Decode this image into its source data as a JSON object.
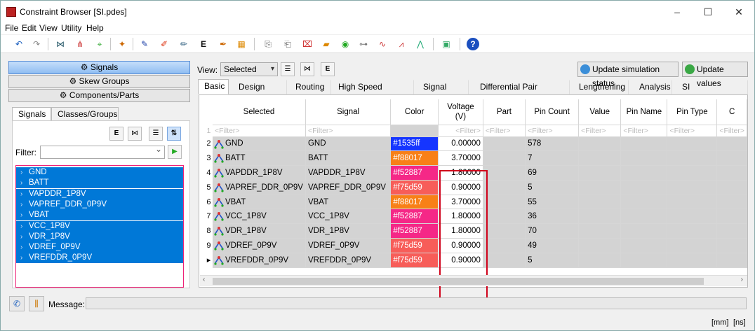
{
  "window": {
    "title": "Constraint Browser [SI.pdes]"
  },
  "menu": [
    "File",
    "Edit",
    "View",
    "Utility",
    "Help"
  ],
  "left": {
    "nav": {
      "signals": "Signals",
      "skew_groups": "Skew Groups",
      "components": "Components/Parts"
    },
    "tabs": [
      "Signals",
      "Classes/Groups"
    ],
    "filter_label": "Filter:",
    "nets": [
      "GND",
      "BATT",
      "VAPDDR_1P8V",
      "VAPREF_DDR_0P9V",
      "VBAT",
      "VCC_1P8V",
      "VDR_1P8V",
      "VDREF_0P9V",
      "VREFDDR_0P9V"
    ]
  },
  "right": {
    "view_label": "View:",
    "view_value": "Selected",
    "update_sim": "Update simulation status",
    "update_values": "Update values",
    "tabs": [
      "Basic",
      "Design Rule",
      "Routing",
      "High Speed Routing",
      "Signal Class",
      "Differential Pair Routing",
      "Lengthening",
      "Analysis",
      "SI Measurements"
    ],
    "columns": [
      "Selected",
      "Signal",
      "Color",
      "Voltage\n(V)",
      "Part",
      "Pin Count",
      "Value",
      "Pin Name",
      "Pin Type",
      "C"
    ],
    "filter_placeholder": "<Filter>",
    "row_numbers": [
      "1",
      "2",
      "3",
      "4",
      "5",
      "6",
      "7",
      "8",
      "9",
      "▸"
    ],
    "rows": [
      {
        "selected": "GND",
        "signal": "GND",
        "color": "#1535ff",
        "voltage": "0.00000",
        "pin_count": "578"
      },
      {
        "selected": "BATT",
        "signal": "BATT",
        "color": "#f88017",
        "voltage": "3.70000",
        "pin_count": "7"
      },
      {
        "selected": "VAPDDR_1P8V",
        "signal": "VAPDDR_1P8V",
        "color": "#f52887",
        "voltage": "1.80000",
        "pin_count": "69"
      },
      {
        "selected": "VAPREF_DDR_0P9V",
        "signal": "VAPREF_DDR_0P9V",
        "color": "#f75d59",
        "voltage": "0.90000",
        "pin_count": "5"
      },
      {
        "selected": "VBAT",
        "signal": "VBAT",
        "color": "#f88017",
        "voltage": "3.70000",
        "pin_count": "55"
      },
      {
        "selected": "VCC_1P8V",
        "signal": "VCC_1P8V",
        "color": "#f52887",
        "voltage": "1.80000",
        "pin_count": "36"
      },
      {
        "selected": "VDR_1P8V",
        "signal": "VDR_1P8V",
        "color": "#f52887",
        "voltage": "1.80000",
        "pin_count": "70"
      },
      {
        "selected": "VDREF_0P9V",
        "signal": "VDREF_0P9V",
        "color": "#f75d59",
        "voltage": "0.90000",
        "pin_count": "49"
      },
      {
        "selected": "VREFDDR_0P9V",
        "signal": "VREFDDR_0P9V",
        "color": "#f75d59",
        "voltage": "0.90000",
        "pin_count": "5"
      }
    ]
  },
  "status": {
    "message_label": "Message:",
    "units_mm": "[mm]",
    "units_ns": "[ns]"
  }
}
